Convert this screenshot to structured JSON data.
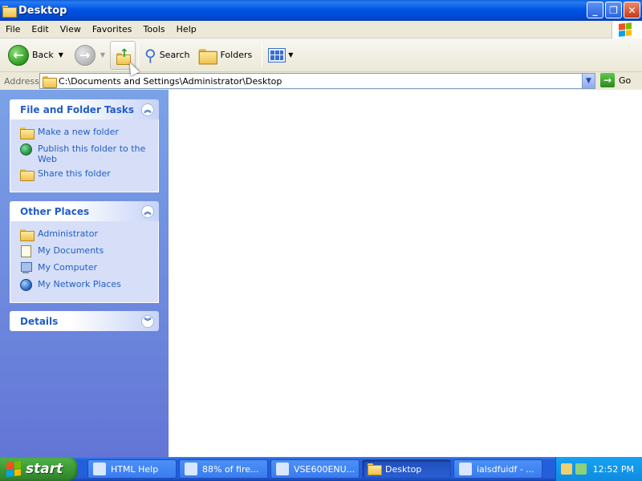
{
  "window": {
    "title": "Desktop"
  },
  "menu": {
    "items": [
      "File",
      "Edit",
      "View",
      "Favorites",
      "Tools",
      "Help"
    ]
  },
  "toolbar": {
    "back_label": "Back",
    "search_label": "Search",
    "folders_label": "Folders"
  },
  "address": {
    "label": "Address",
    "value": "C:\\Documents and Settings\\Administrator\\Desktop",
    "go_label": "Go"
  },
  "taskpane": {
    "file_tasks": {
      "title": "File and Folder Tasks",
      "items": [
        "Make a new folder",
        "Publish this folder to the Web",
        "Share this folder"
      ]
    },
    "other_places": {
      "title": "Other Places",
      "items": [
        "Administrator",
        "My Documents",
        "My Computer",
        "My Network Places"
      ]
    },
    "details": {
      "title": "Details"
    }
  },
  "taskbar": {
    "start_label": "start",
    "buttons": [
      "HTML Help",
      "88% of fire...",
      "VSE600ENU...",
      "Desktop",
      "ialsdfuidf - ..."
    ],
    "active_index": 3,
    "clock": "12:52 PM"
  },
  "colors": {
    "title_blue": "#0055e5",
    "taskpane_link": "#215dc6",
    "start_green": "#3c9a36"
  }
}
